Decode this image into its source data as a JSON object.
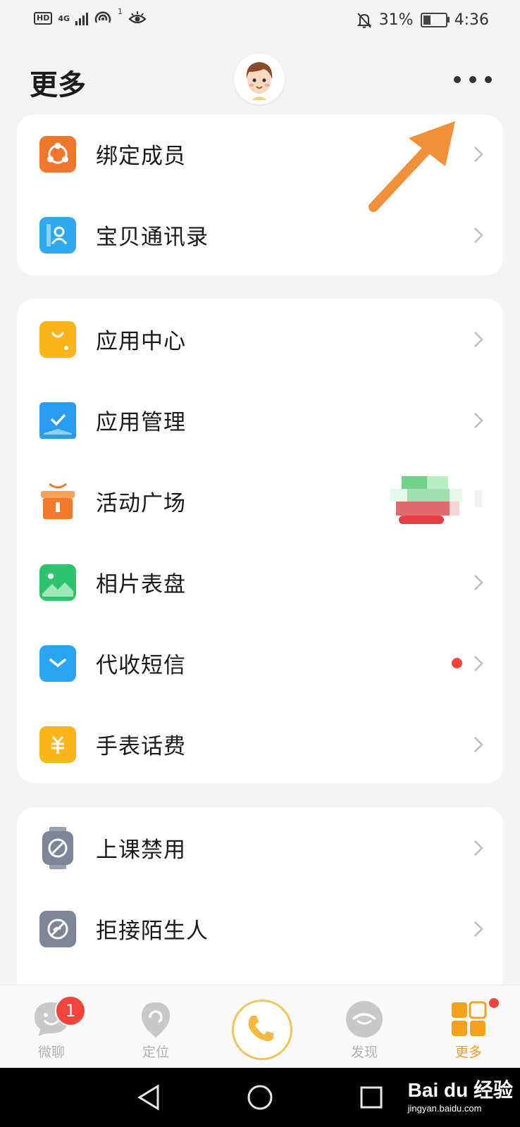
{
  "status_bar": {
    "hd": "HD",
    "network": "4G",
    "hotspot_count": "1",
    "battery_percent": "31%",
    "battery_level": 0.31,
    "time": "4:36"
  },
  "header": {
    "title": "更多"
  },
  "group1": [
    {
      "label": "绑定成员",
      "icon": "bind-members-icon",
      "color": "#f0762c"
    },
    {
      "label": "宝贝通讯录",
      "icon": "contacts-icon",
      "color": "#2fa8ee"
    }
  ],
  "group2": [
    {
      "label": "应用中心",
      "icon": "shopping-bag-icon",
      "color": "#fbb518"
    },
    {
      "label": "应用管理",
      "icon": "app-manage-icon",
      "color": "#2a9cf0"
    },
    {
      "label": "活动广场",
      "icon": "gift-icon",
      "color": "#f37a2a"
    },
    {
      "label": "相片表盘",
      "icon": "photo-icon",
      "color": "#2dc46d"
    },
    {
      "label": "代收短信",
      "icon": "mail-icon",
      "color": "#2aa5f2"
    },
    {
      "label": "手表话费",
      "icon": "yuan-icon",
      "color": "#fbb518"
    }
  ],
  "group3": [
    {
      "label": "上课禁用",
      "icon": "class-ban-icon",
      "color": "#7d8596"
    },
    {
      "label": "拒接陌生人",
      "icon": "reject-stranger-icon",
      "color": "#7d8596"
    }
  ],
  "tabbar": {
    "tabs": [
      {
        "label": "微聊",
        "badge": "1"
      },
      {
        "label": "定位"
      },
      {
        "label": "发现"
      },
      {
        "label": "更多"
      }
    ],
    "active_color": "#f29b2c"
  },
  "watermark": {
    "brand": "Bai du 经验",
    "url": "jingyan.baidu.com"
  }
}
